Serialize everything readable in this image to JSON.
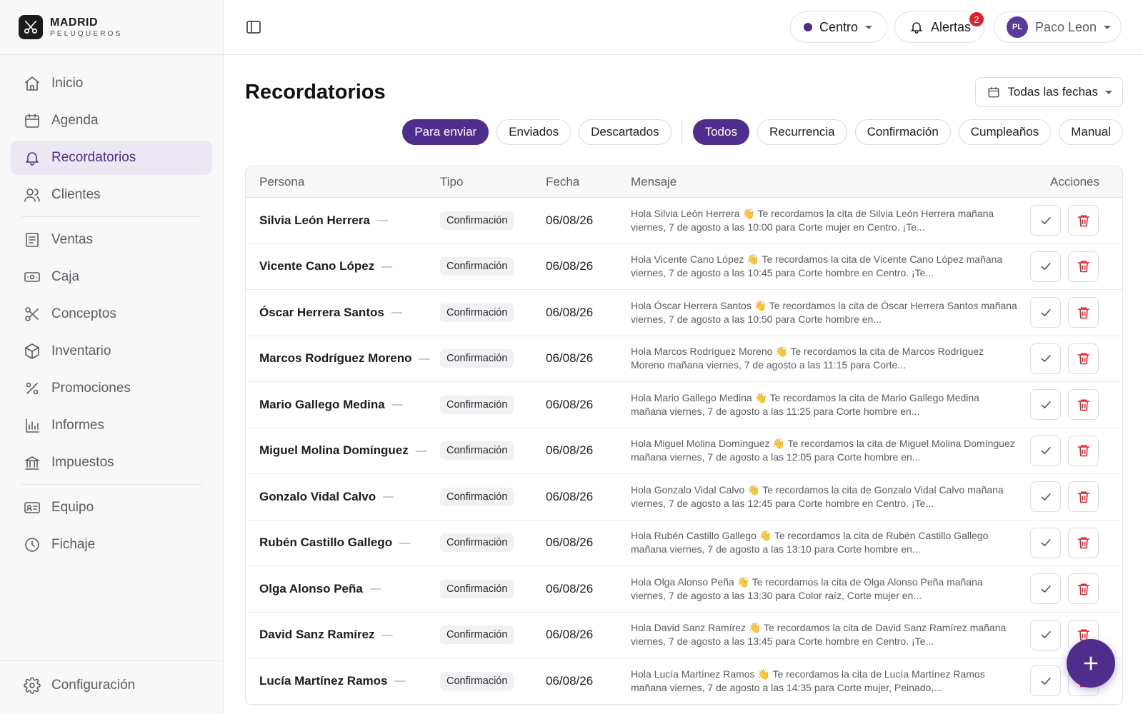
{
  "brand": {
    "title": "MADRID",
    "subtitle": "PELUQUEROS"
  },
  "nav": {
    "items": [
      {
        "label": "Inicio",
        "icon": "home-icon"
      },
      {
        "label": "Agenda",
        "icon": "calendar-icon"
      },
      {
        "label": "Recordatorios",
        "icon": "bell-icon",
        "active": true
      },
      {
        "label": "Clientes",
        "icon": "users-icon"
      },
      {
        "label": "Ventas",
        "icon": "receipt-icon"
      },
      {
        "label": "Caja",
        "icon": "cash-icon"
      },
      {
        "label": "Conceptos",
        "icon": "scissors-icon"
      },
      {
        "label": "Inventario",
        "icon": "box-icon"
      },
      {
        "label": "Promociones",
        "icon": "percent-icon"
      },
      {
        "label": "Informes",
        "icon": "bar-chart-icon"
      },
      {
        "label": "Impuestos",
        "icon": "bank-icon"
      },
      {
        "label": "Equipo",
        "icon": "id-card-icon"
      },
      {
        "label": "Fichaje",
        "icon": "clock-icon"
      }
    ],
    "settings": {
      "label": "Configuración",
      "icon": "gear-icon"
    }
  },
  "topbar": {
    "location": "Centro",
    "alerts_label": "Alertas",
    "alerts_count": "2",
    "user_initials": "PL",
    "user_name": "Paco Leon"
  },
  "page": {
    "title": "Recordatorios",
    "date_filter": "Todas las fechas",
    "status_filters": [
      "Para enviar",
      "Enviados",
      "Descartados"
    ],
    "type_filters": [
      "Todos",
      "Recurrencia",
      "Confirmación",
      "Cumpleaños",
      "Manual"
    ]
  },
  "table": {
    "headers": [
      "Persona",
      "Tipo",
      "Fecha",
      "Mensaje",
      "Acciones"
    ],
    "rows": [
      {
        "persona": "Silvia León Herrera",
        "tipo": "Confirmación",
        "fecha": "06/08/26",
        "mensaje": "Hola Silvia León Herrera 👋 Te recordamos la cita de Silvia León Herrera mañana viernes, 7 de agosto a las 10:00 para Corte mujer en Centro. ¡Te..."
      },
      {
        "persona": "Vicente Cano López",
        "tipo": "Confirmación",
        "fecha": "06/08/26",
        "mensaje": "Hola Vicente Cano López 👋 Te recordamos la cita de Vicente Cano López mañana viernes, 7 de agosto a las 10:45 para Corte hombre en Centro. ¡Te..."
      },
      {
        "persona": "Óscar Herrera Santos",
        "tipo": "Confirmación",
        "fecha": "06/08/26",
        "mensaje": "Hola Óscar Herrera Santos 👋 Te recordamos la cita de Óscar Herrera Santos mañana viernes, 7 de agosto a las 10:50 para Corte hombre en..."
      },
      {
        "persona": "Marcos Rodríguez Moreno",
        "tipo": "Confirmación",
        "fecha": "06/08/26",
        "mensaje": "Hola Marcos Rodríguez Moreno 👋 Te recordamos la cita de Marcos Rodríguez Moreno mañana viernes, 7 de agosto a las 11:15 para Corte..."
      },
      {
        "persona": "Mario Gallego Medina",
        "tipo": "Confirmación",
        "fecha": "06/08/26",
        "mensaje": "Hola Mario Gallego Medina 👋 Te recordamos la cita de Mario Gallego Medina mañana viernes, 7 de agosto a las 11:25 para Corte hombre en..."
      },
      {
        "persona": "Miguel Molina Domínguez",
        "tipo": "Confirmación",
        "fecha": "06/08/26",
        "mensaje": "Hola Miguel Molina Domínguez 👋 Te recordamos la cita de Miguel Molina Domínguez mañana viernes, 7 de agosto a las 12:05 para Corte hombre en..."
      },
      {
        "persona": "Gonzalo Vidal Calvo",
        "tipo": "Confirmación",
        "fecha": "06/08/26",
        "mensaje": "Hola Gonzalo Vidal Calvo 👋 Te recordamos la cita de Gonzalo Vidal Calvo mañana viernes, 7 de agosto a las 12:45 para Corte hombre en Centro. ¡Te..."
      },
      {
        "persona": "Rubén Castillo Gallego",
        "tipo": "Confirmación",
        "fecha": "06/08/26",
        "mensaje": "Hola Rubén Castillo Gallego 👋 Te recordamos la cita de Rubén Castillo Gallego mañana viernes, 7 de agosto a las 13:10 para Corte hombre en..."
      },
      {
        "persona": "Olga Alonso Peña",
        "tipo": "Confirmación",
        "fecha": "06/08/26",
        "mensaje": "Hola Olga Alonso Peña 👋 Te recordamos la cita de Olga Alonso Peña mañana viernes, 7 de agosto a las 13:30 para Color raíz, Corte mujer en..."
      },
      {
        "persona": "David Sanz Ramírez",
        "tipo": "Confirmación",
        "fecha": "06/08/26",
        "mensaje": "Hola David Sanz Ramírez 👋 Te recordamos la cita de David Sanz Ramírez mañana viernes, 7 de agosto a las 13:45 para Corte hombre en Centro. ¡Te..."
      },
      {
        "persona": "Lucía Martínez Ramos",
        "tipo": "Confirmación",
        "fecha": "06/08/26",
        "mensaje": "Hola Lucía Martínez Ramos 👋 Te recordamos la cita de Lucía Martínez Ramos mañana viernes, 7 de agosto a las 14:35 para Corte mujer, Peinado,..."
      }
    ]
  },
  "colors": {
    "accent": "#4f2d8c",
    "danger": "#e2202a",
    "alert_badge": "#e2202a"
  },
  "icons": {
    "sidebar_toggle": "sidebar-toggle-icon",
    "check": "check-icon",
    "delete": "trash-icon",
    "fab": "plus-icon",
    "calendar": "calendar-icon",
    "bell": "bell-icon"
  }
}
